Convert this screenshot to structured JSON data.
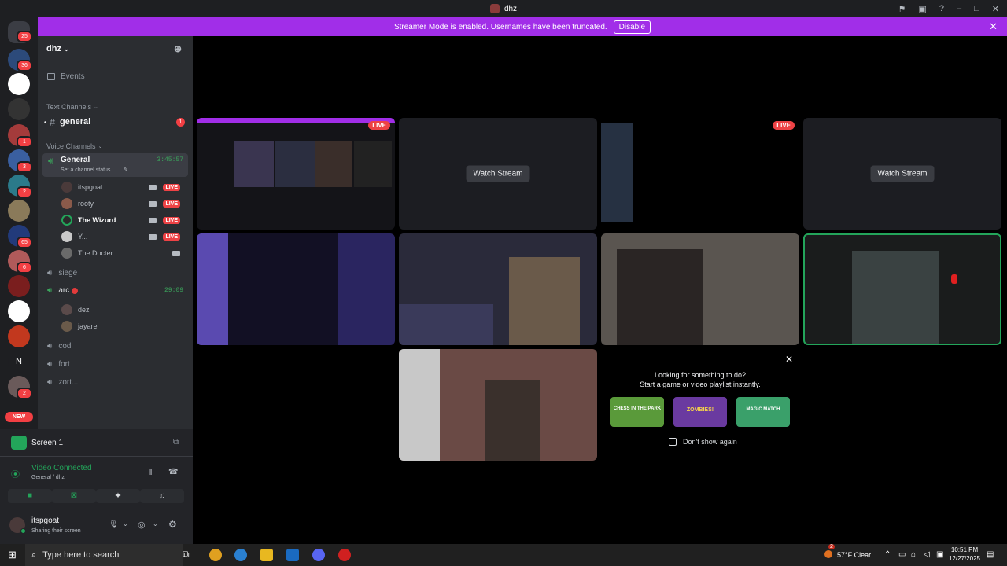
{
  "window": {
    "title": "dhz"
  },
  "banner": {
    "text": "Streamer Mode is enabled. Usernames have been truncated.",
    "button": "Disable"
  },
  "servers": {
    "badges": [
      "25",
      "36",
      "1",
      "3",
      "2",
      "65",
      "6",
      "2"
    ],
    "new_label": "NEW",
    "letter_item": "N"
  },
  "guild": {
    "name": "dhz",
    "events_label": "Events",
    "text_category": "Text Channels",
    "voice_category": "Voice Channels",
    "general_text": "general",
    "general_text_badge": "1",
    "general_voice": "General",
    "general_voice_time": "3:45:57",
    "set_status": "Set a channel status",
    "general_users": [
      "itspgoat",
      "rooty",
      "The Wizurd",
      "Y...",
      "The Docter"
    ],
    "live_label": "LIVE",
    "siege": "siege",
    "arc": "arc",
    "arc_time": "29:09",
    "arc_users": [
      "dez",
      "jayare"
    ],
    "cod": "cod",
    "fort": "fort",
    "zort": "zort..."
  },
  "panel": {
    "screen_label": "Screen 1",
    "video_connected": "Video Connected",
    "location": "General / dhz",
    "username": "itspgoat",
    "user_status": "Sharing their screen"
  },
  "stage": {
    "watch_stream": "Watch Stream",
    "live": "LIVE",
    "activity_title": "Looking for something to do?",
    "activity_subtitle": "Start a game or video playlist instantly.",
    "dont_show": "Don't show again",
    "games": [
      "CHESS IN THE PARK",
      "ZOMBIES!",
      "MAGIC MATCH"
    ]
  },
  "taskbar": {
    "search_placeholder": "Type here to search",
    "weather": "57°F  Clear",
    "time": "10:51 PM",
    "date": "12/27/2025",
    "weather_badge": "2"
  },
  "colors": {
    "accent": "#a12ee8",
    "live": "#ed4245",
    "online": "#23a55a",
    "speaking": "#3ba55c"
  }
}
